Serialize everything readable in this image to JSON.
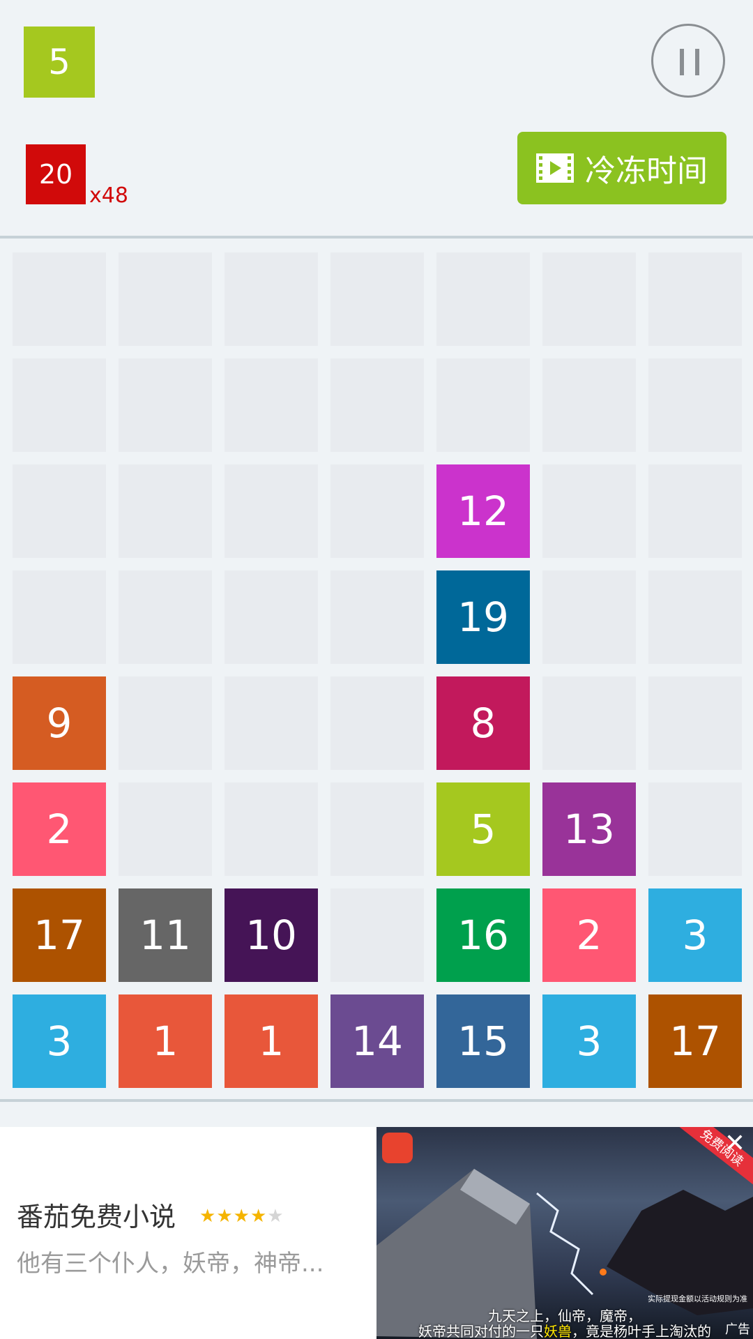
{
  "header": {
    "next_tile": {
      "value": "5",
      "color": "#a5c81f"
    },
    "goal_tile": {
      "value": "20",
      "color": "#d10a0a"
    },
    "goal_multiplier": "x48",
    "freeze_button_label": "冷冻时间",
    "freeze_icon": "film-icon",
    "pause_icon": "pause-icon"
  },
  "board": {
    "rows": 8,
    "cols": 7,
    "tiles": [
      {
        "row": 2,
        "col": 4,
        "value": "12",
        "color": "#cb33cc"
      },
      {
        "row": 3,
        "col": 4,
        "value": "19",
        "color": "#006899"
      },
      {
        "row": 4,
        "col": 0,
        "value": "9",
        "color": "#d55c22"
      },
      {
        "row": 4,
        "col": 4,
        "value": "8",
        "color": "#c2195c"
      },
      {
        "row": 5,
        "col": 0,
        "value": "2",
        "color": "#ff5773"
      },
      {
        "row": 5,
        "col": 4,
        "value": "5",
        "color": "#a5c81f"
      },
      {
        "row": 5,
        "col": 5,
        "value": "13",
        "color": "#993399"
      },
      {
        "row": 6,
        "col": 0,
        "value": "17",
        "color": "#ad5200"
      },
      {
        "row": 6,
        "col": 1,
        "value": "11",
        "color": "#666666"
      },
      {
        "row": 6,
        "col": 2,
        "value": "10",
        "color": "#451456"
      },
      {
        "row": 6,
        "col": 4,
        "value": "16",
        "color": "#00a04d"
      },
      {
        "row": 6,
        "col": 5,
        "value": "2",
        "color": "#ff5773"
      },
      {
        "row": 6,
        "col": 6,
        "value": "3",
        "color": "#2eaee0"
      },
      {
        "row": 7,
        "col": 0,
        "value": "3",
        "color": "#2eaee0"
      },
      {
        "row": 7,
        "col": 1,
        "value": "1",
        "color": "#e8573a"
      },
      {
        "row": 7,
        "col": 2,
        "value": "1",
        "color": "#e8573a"
      },
      {
        "row": 7,
        "col": 3,
        "value": "14",
        "color": "#6b4b91"
      },
      {
        "row": 7,
        "col": 4,
        "value": "15",
        "color": "#336699"
      },
      {
        "row": 7,
        "col": 5,
        "value": "3",
        "color": "#2eaee0"
      },
      {
        "row": 7,
        "col": 6,
        "value": "17",
        "color": "#ad5200"
      }
    ]
  },
  "ad": {
    "title": "番茄免费小说",
    "rating": 4,
    "max_rating": 5,
    "description": "他有三个仆人，妖帝，神帝...",
    "badge": "免费阅读",
    "caption_line1": "九天之上，仙帝，魔帝，",
    "caption_line2_a": "妖帝共同对付的一只",
    "caption_line2_hl": "妖兽",
    "caption_line2_b": "，竟是杨叶手上淘汰的",
    "small_print": "实际提现金额以活动规则为准",
    "tag": "广告",
    "close_icon": "close-icon"
  }
}
